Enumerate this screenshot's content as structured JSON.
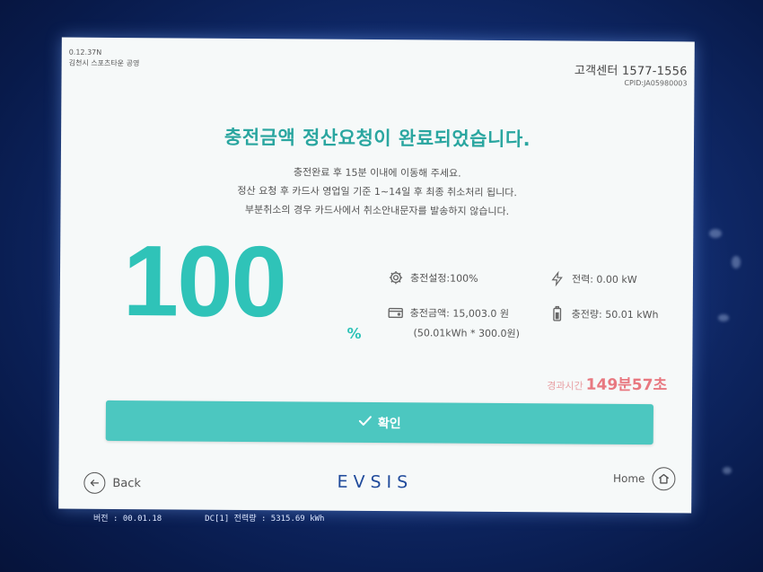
{
  "header": {
    "version": "0.12.37N",
    "location": "김천시 스포츠타운 공영",
    "support": "고객센터 1577-1556",
    "cpid": "CPID:JA05980003"
  },
  "title": "충전금액 정산요청이 완료되었습니다.",
  "notices": [
    "충전완료 후 15분 이내에 이동해 주세요.",
    "정산 요청 후 카드사 영업일 기준 1~14일 후 최종 취소처리 됩니다.",
    "부분취소의 경우 카드사에서 취소안내문자를 발송하지 않습니다."
  ],
  "charge": {
    "percent": "100",
    "percent_sign": "%",
    "setting": "충전설정:100%",
    "power": "전력: 0.00 kW",
    "amount": "충전금액: 15,003.0 원",
    "amount_detail": "(50.01kWh * 300.0원)",
    "energy": "충전량: 50.01 kWh"
  },
  "elapsed": {
    "label": "경과시간",
    "value": "149분57초"
  },
  "confirm_button": {
    "icon": "check-icon",
    "label": "확인"
  },
  "nav": {
    "back_label": "Back",
    "home_label": "Home"
  },
  "brand": "EVSIS",
  "footer": {
    "version": "버전 : 00.01.18",
    "meter": "DC[1] 전력량 : 5315.69 kWh"
  },
  "colors": {
    "accent": "#2fc3b8",
    "button": "#4cc7c0",
    "title": "#2aa6a0",
    "elapsed": "#e87880",
    "brand": "#1f4a9b"
  }
}
